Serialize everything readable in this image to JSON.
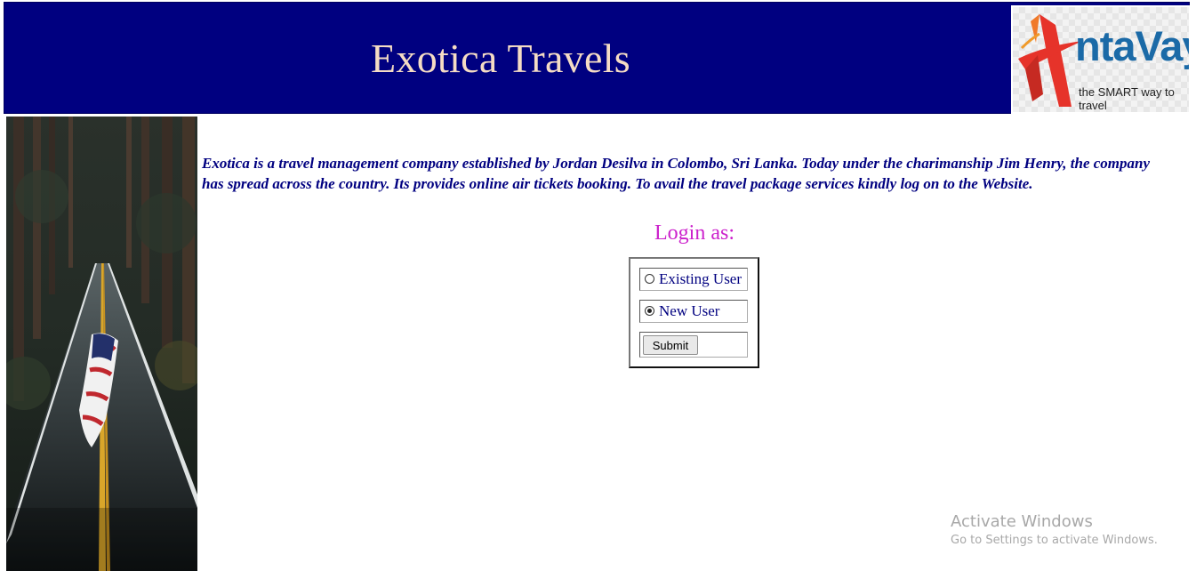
{
  "header": {
    "title": "Exotica Travels",
    "logo": {
      "brand": "ntaVaya",
      "tagline": "the SMART way to travel"
    }
  },
  "intro": {
    "text": "Exotica is a travel management company established by Jordan Desilva in Colombo, Sri Lanka. Today under the charimanship Jim Henry, the company has spread across the country. Its provides online air tickets booking. To avail the travel package services kindly log on to the Website."
  },
  "login": {
    "heading": "Login as:",
    "options": [
      {
        "label": "Existing User",
        "selected": false
      },
      {
        "label": "New User",
        "selected": true
      }
    ],
    "submit_label": "Submit"
  },
  "watermark": {
    "title": "Activate Windows",
    "subtitle": "Go to Settings to activate Windows."
  },
  "colors": {
    "header_bg": "#000080",
    "title_text": "#f5dcc4",
    "intro_text": "#000080",
    "login_heading": "#cc22cc"
  }
}
